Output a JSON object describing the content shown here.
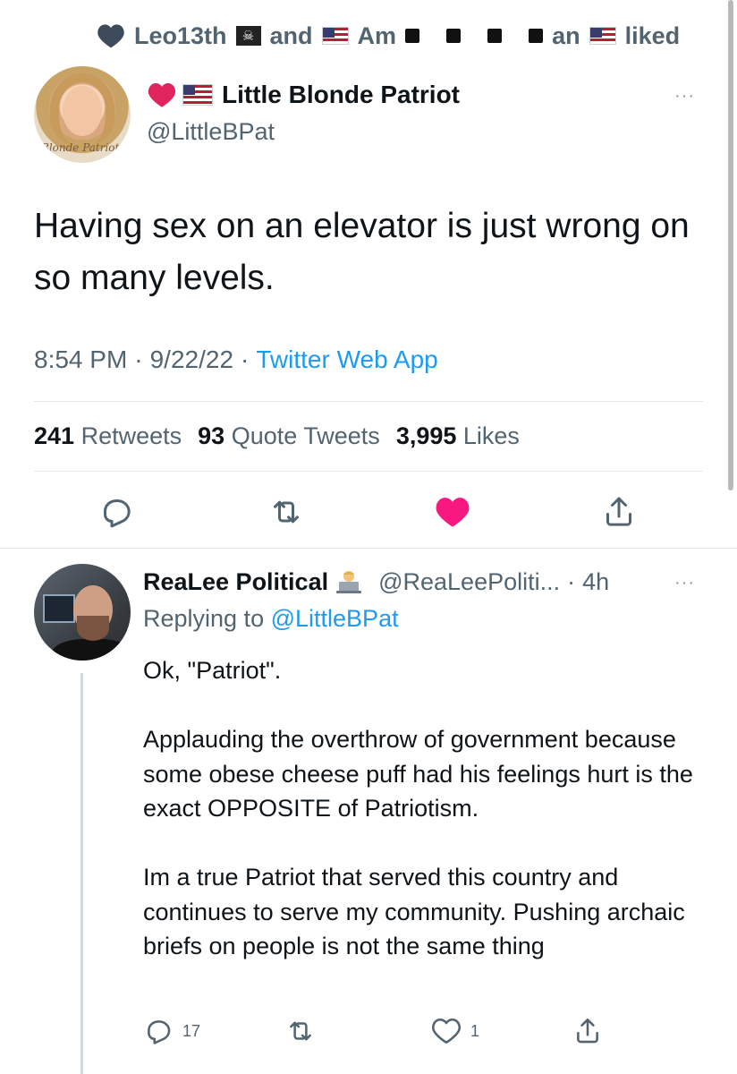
{
  "social_context": {
    "user1": "Leo13th",
    "user1_flag": "🏴‍☠️",
    "and": "and",
    "user2_prefix": "Am",
    "user2_suffix": "an",
    "liked": "liked"
  },
  "tweet": {
    "display_name": "Little Blonde Patriot",
    "handle": "@LittleBPat",
    "avatar_signature": "Blonde Patriot",
    "text": "Having sex on an elevator is just wrong on so many levels.",
    "time": "8:54 PM",
    "date": "9/22/22",
    "source": "Twitter Web App",
    "retweets_count": "241",
    "retweets_label": "Retweets",
    "quotes_count": "93",
    "quotes_label": "Quote Tweets",
    "likes_count": "3,995",
    "likes_label": "Likes",
    "more_label": "···"
  },
  "reply": {
    "display_name": "ReaLee Political",
    "handle": "@ReaLeePoliti...",
    "age": "4h",
    "replying_prefix": "Replying to",
    "replying_to": "@LittleBPat",
    "paragraphs": [
      "Ok, \"Patriot\".",
      "Applauding the overthrow of government because some obese cheese puff had his feelings hurt is the exact OPPOSITE of Patriotism.",
      "Im a true Patriot that served this country and continues to serve my community. Pushing archaic briefs on people is not the same thing"
    ],
    "reply_count": "17",
    "like_count": "1",
    "more_label": "···"
  },
  "colors": {
    "text": "#0f1419",
    "secondary": "#536471",
    "link": "#1d9bf0",
    "like_pink": "#f91880",
    "divider": "#e1e8ed"
  },
  "icons": [
    "heart-icon",
    "reply-icon",
    "retweet-icon",
    "liked-heart-icon",
    "share-icon",
    "more-icon",
    "us-flag-icon",
    "pirate-flag-icon",
    "laptop-emoji-icon"
  ]
}
